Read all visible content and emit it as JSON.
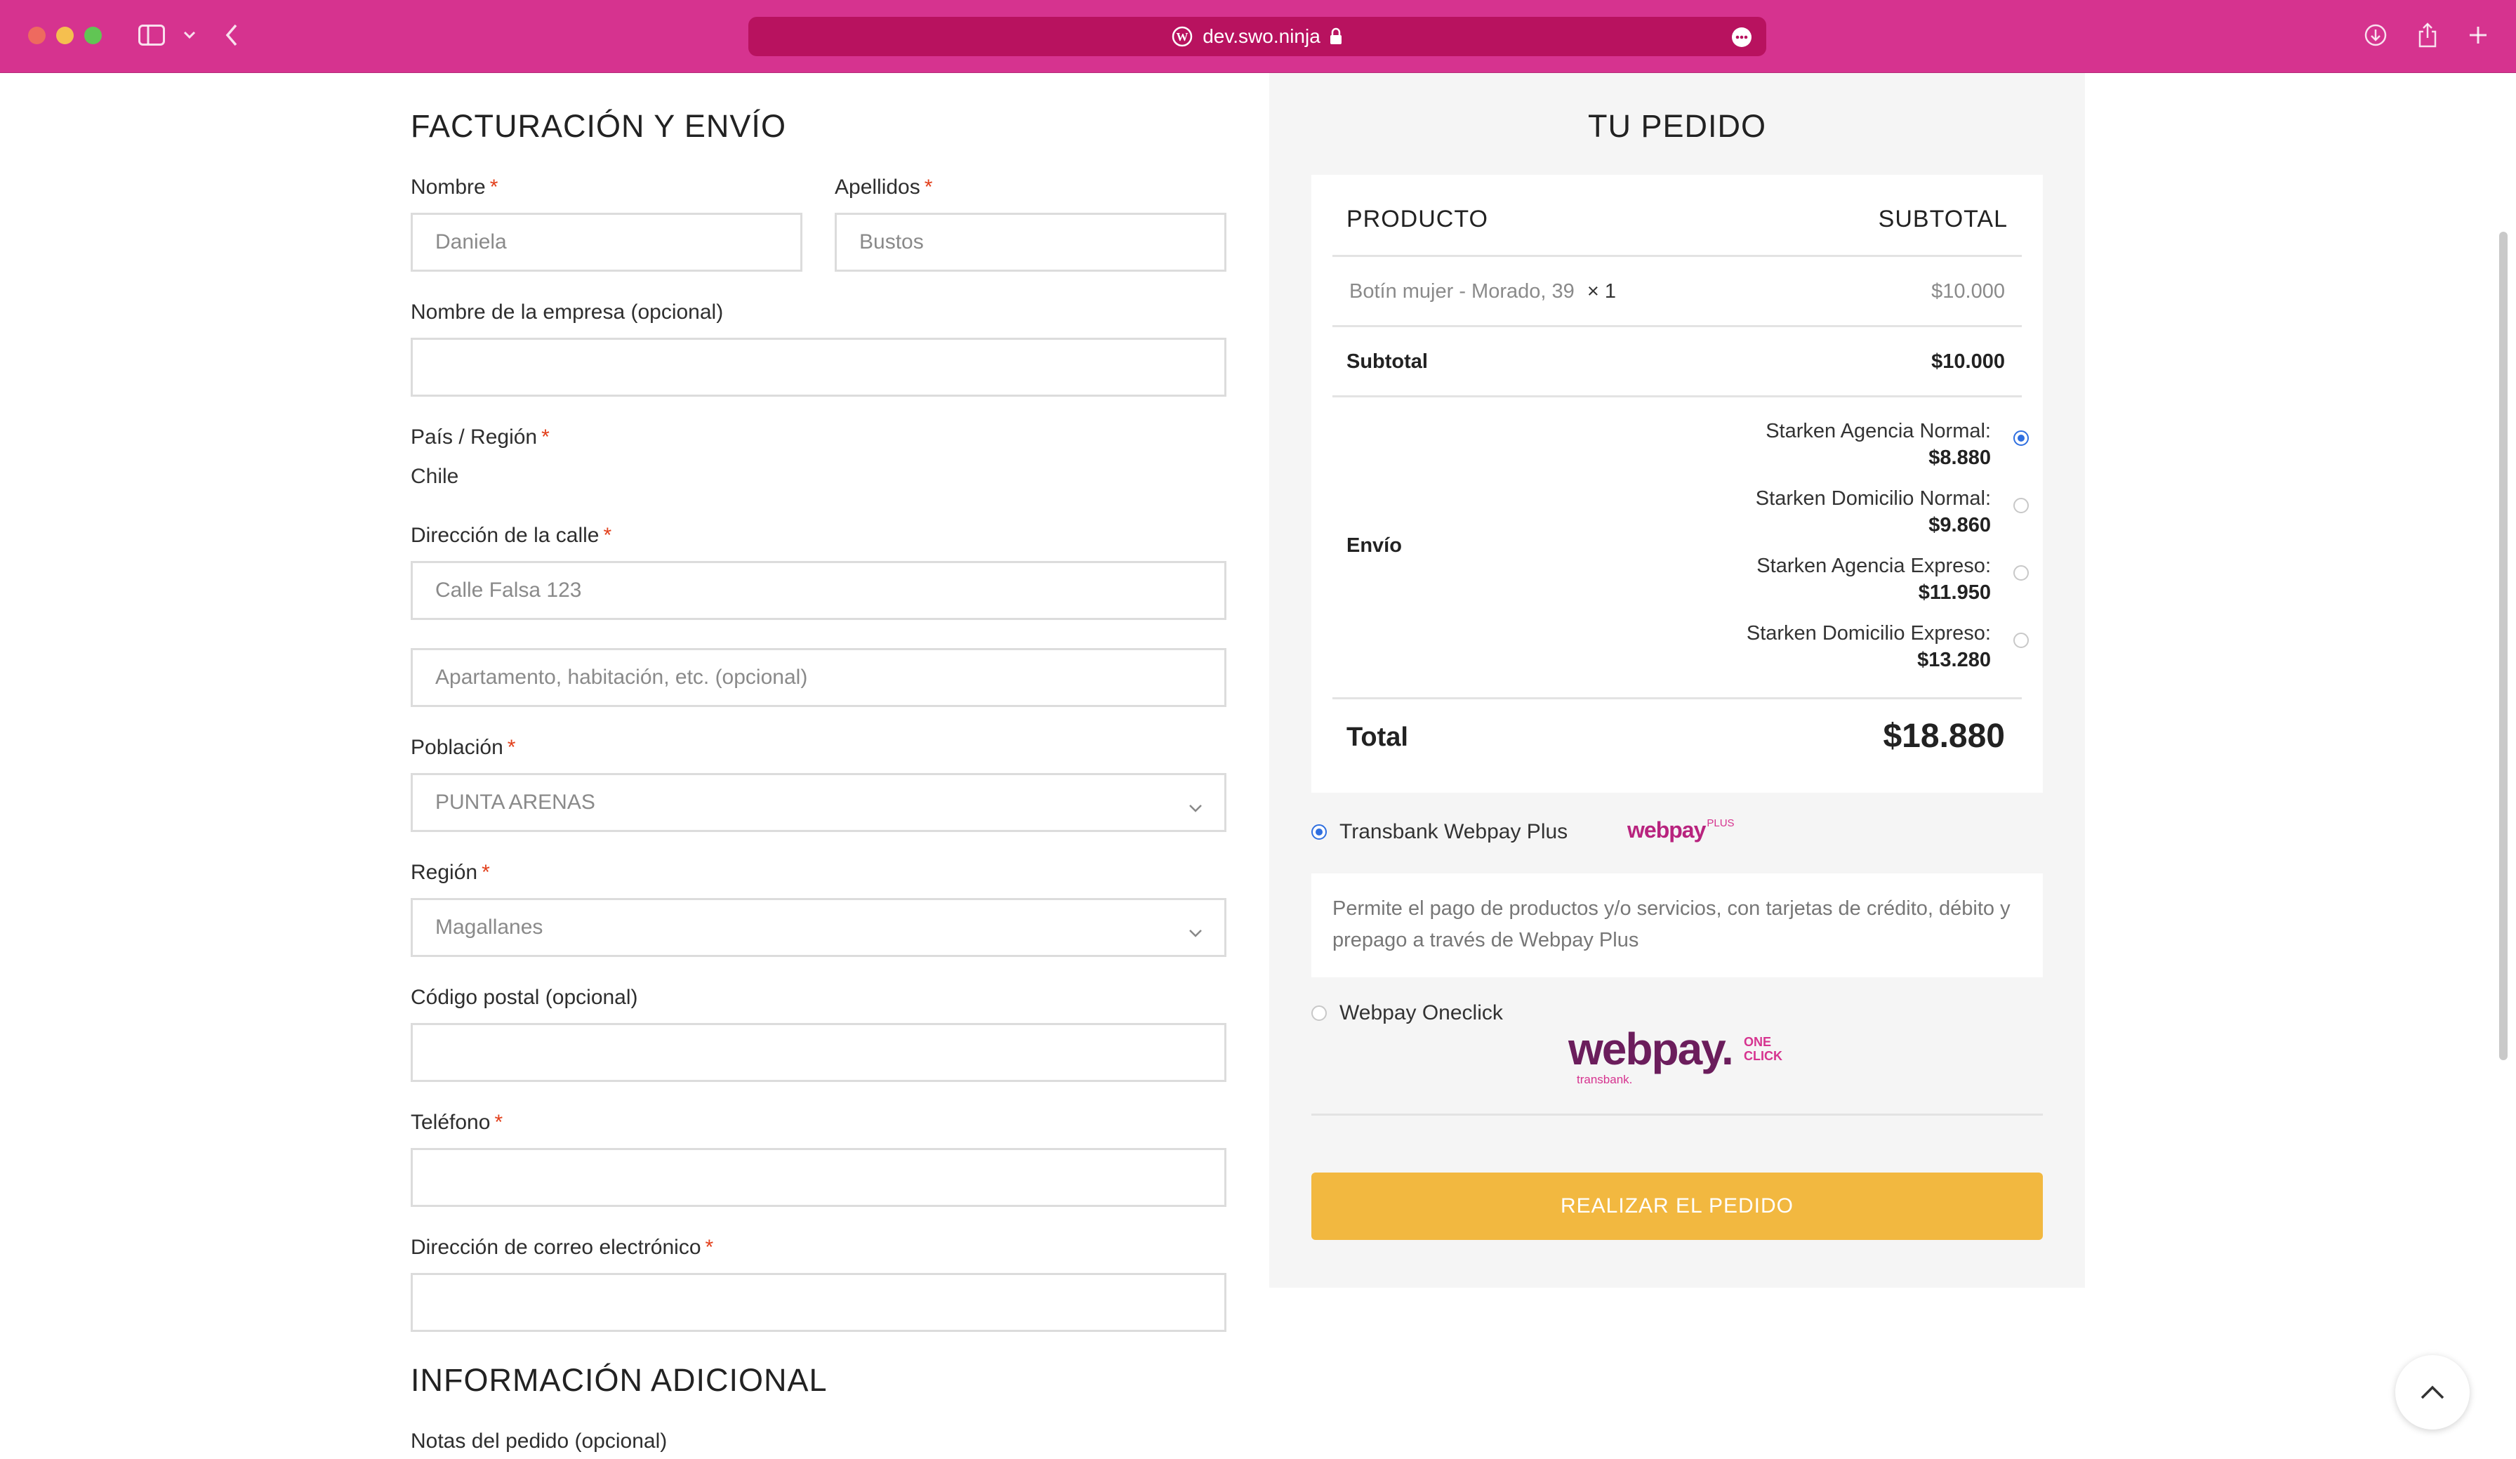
{
  "browser": {
    "url": "dev.swo.ninja",
    "accent": "#d6338f",
    "icons": [
      "sidebar-icon",
      "chevron-down-icon",
      "back-icon",
      "wordpress-icon",
      "lock-icon",
      "more-icon",
      "download-icon",
      "share-icon",
      "plus-icon"
    ]
  },
  "billing": {
    "title": "FACTURACIÓN Y ENVÍO",
    "first_name": {
      "label": "Nombre",
      "value": "Daniela"
    },
    "last_name": {
      "label": "Apellidos",
      "value": "Bustos"
    },
    "company": {
      "label": "Nombre de la empresa (opcional)",
      "value": ""
    },
    "country": {
      "label": "País / Región",
      "value": "Chile"
    },
    "street": {
      "label": "Dirección de la calle",
      "value": "Calle Falsa 123",
      "placeholder2": "Apartamento, habitación, etc. (opcional)"
    },
    "city": {
      "label": "Población",
      "value": "PUNTA ARENAS"
    },
    "region": {
      "label": "Región",
      "value": "Magallanes"
    },
    "postcode": {
      "label": "Código postal (opcional)",
      "value": ""
    },
    "phone": {
      "label": "Teléfono",
      "value": ""
    },
    "email": {
      "label": "Dirección de correo electrónico",
      "value": ""
    },
    "required_mark": "*"
  },
  "additional": {
    "title": "INFORMACIÓN ADICIONAL",
    "notes_label": "Notas del pedido (opcional)"
  },
  "order": {
    "title": "TU PEDIDO",
    "col_product": "PRODUCTO",
    "col_subtotal": "SUBTOTAL",
    "item_name": "Botín mujer - Morado, 39",
    "item_qty": "× 1",
    "item_price": "$10.000",
    "subtotal_label": "Subtotal",
    "subtotal_value": "$10.000",
    "shipping_label": "Envío",
    "shipping_options": [
      {
        "name": "Starken Agencia Normal:",
        "price": "$8.880",
        "selected": true
      },
      {
        "name": "Starken Domicilio Normal:",
        "price": "$9.860",
        "selected": false
      },
      {
        "name": "Starken Agencia Expreso:",
        "price": "$11.950",
        "selected": false
      },
      {
        "name": "Starken Domicilio Expreso:",
        "price": "$13.280",
        "selected": false
      }
    ],
    "total_label": "Total",
    "total_value": "$18.880"
  },
  "payment": {
    "webpay_plus_label": "Transbank Webpay Plus",
    "webpay_plus_logo_text": "webpay",
    "webpay_plus_logo_sup": "PLUS",
    "webpay_plus_desc": "Permite el pago de productos y/o servicios, con tarjetas de crédito, débito y prepago a través de Webpay Plus",
    "oneclick_label": "Webpay Oneclick",
    "oneclick_logo_text": "webpay.",
    "oneclick_logo_one": "ONE",
    "oneclick_logo_click": "CLICK",
    "oneclick_logo_sub": "transbank.",
    "place_order": "REALIZAR EL PEDIDO"
  }
}
